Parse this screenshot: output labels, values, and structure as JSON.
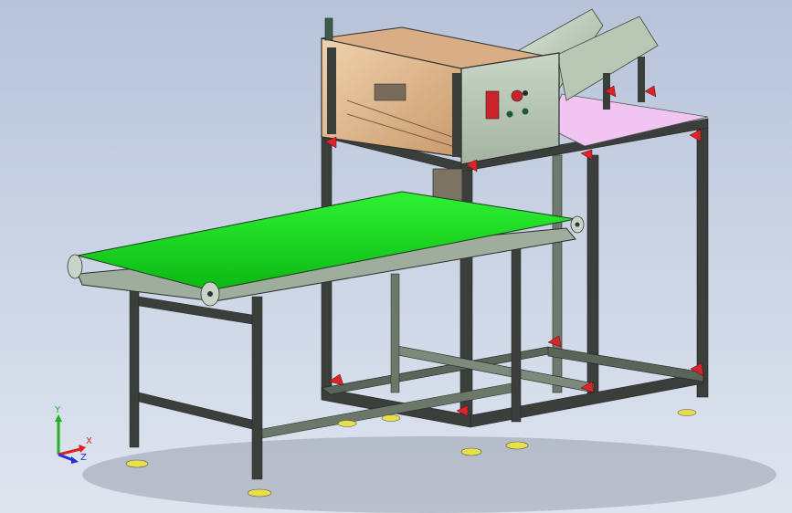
{
  "axes": {
    "y": "Y",
    "x": "X",
    "z": "Z"
  },
  "colors": {
    "background_top": "#b7c3d9",
    "background_bottom": "#dfe5ef",
    "frame": "#3a3f3c",
    "frame_highlight": "#9aa89a",
    "belt": "#14e01c",
    "belt_dark": "#0aa012",
    "roller": "#c8d4c8",
    "guard_panel": "#e6c39a",
    "control_panel": "#b8c6b6",
    "corner_bracket": "#d8242a",
    "foot": "#e8e04a",
    "table_top": "#f2c4f2",
    "axis_x": "#e02020",
    "axis_y": "#20b020",
    "axis_z": "#2030e0"
  },
  "icons": [
    "coordinate-triad-icon",
    "emergency-stop-icon",
    "power-switch-icon"
  ]
}
